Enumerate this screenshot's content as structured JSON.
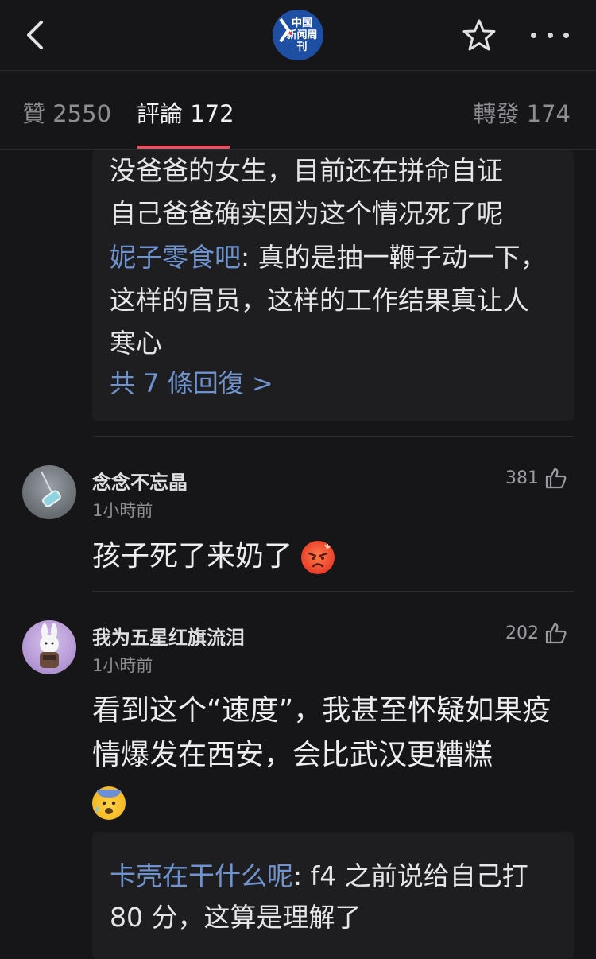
{
  "header": {
    "back_icon": "chevron-left-icon",
    "logo_text": "中国\n新闻周刊",
    "favorite_icon": "star-icon",
    "more_icon": "more-dots-icon"
  },
  "tabs": [
    {
      "label": "贊 2550",
      "active": false
    },
    {
      "label": "評論 172",
      "active": true
    },
    {
      "label": "轉發 174",
      "active": false
    }
  ],
  "accent_color": "#ea4f63",
  "link_color": "#6e93cf",
  "reply_box_1": {
    "line1": "没爸爸的女生，目前还在拼命自证",
    "line2": "自己爸爸确实因为这个情况死了呢",
    "reply_name": "妮子零食吧",
    "reply_text": ": 真的是抽一鞭子动一下，这样的官员，这样的工作结果真让人寒心",
    "more_replies": "共 7 條回復 >"
  },
  "comments": [
    {
      "username": "念念不忘晶",
      "time": "1小時前",
      "likes": "381",
      "content": "孩子死了来奶了",
      "emoji": "angry-face-icon"
    },
    {
      "username": "我为五星红旗流泪",
      "time": "1小時前",
      "likes": "202",
      "content": "看到这个“速度”，我甚至怀疑如果疫情爆发在西安，会比武汉更糟糕",
      "emoji": "anxious-sweat-face-icon"
    }
  ],
  "reply_box_2": {
    "reply_name": "卡壳在干什么呢",
    "reply_text": ": f4 之前说给自己打 80 分，这算是理解了"
  }
}
